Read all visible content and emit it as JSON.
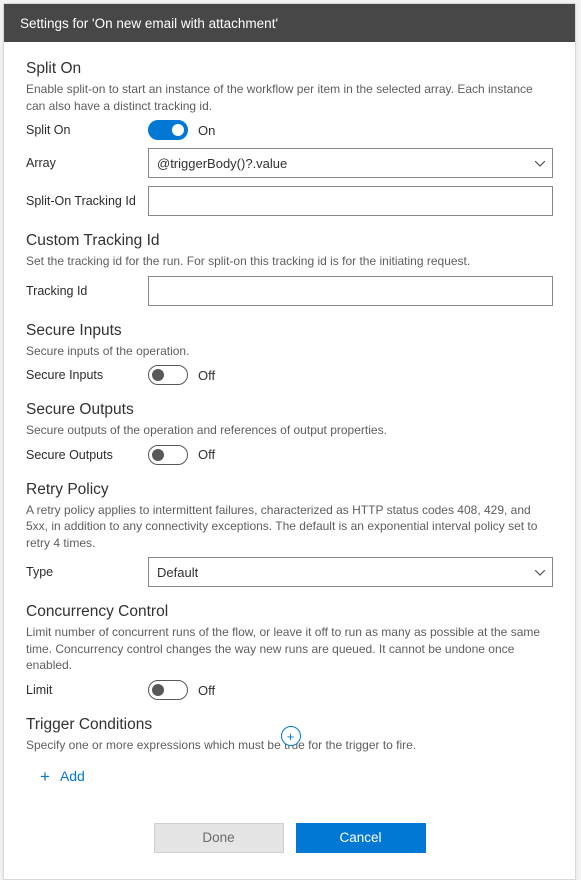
{
  "titlebar": "Settings for 'On new email with attachment'",
  "sections": {
    "splitOn": {
      "title": "Split On",
      "desc": "Enable split-on to start an instance of the workflow per item in the selected array. Each instance can also have a distinct tracking id.",
      "toggleLabel": "Split On",
      "toggleState": "On",
      "arrayLabel": "Array",
      "arrayValue": "@triggerBody()?.value",
      "trackingLabel": "Split-On Tracking Id",
      "trackingValue": ""
    },
    "customTracking": {
      "title": "Custom Tracking Id",
      "desc": "Set the tracking id for the run. For split-on this tracking id is for the initiating request.",
      "fieldLabel": "Tracking Id",
      "fieldValue": ""
    },
    "secureInputs": {
      "title": "Secure Inputs",
      "desc": "Secure inputs of the operation.",
      "toggleLabel": "Secure Inputs",
      "toggleState": "Off"
    },
    "secureOutputs": {
      "title": "Secure Outputs",
      "desc": "Secure outputs of the operation and references of output properties.",
      "toggleLabel": "Secure Outputs",
      "toggleState": "Off"
    },
    "retry": {
      "title": "Retry Policy",
      "desc": "A retry policy applies to intermittent failures, characterized as HTTP status codes 408, 429, and 5xx, in addition to any connectivity exceptions. The default is an exponential interval policy set to retry 4 times.",
      "typeLabel": "Type",
      "typeValue": "Default"
    },
    "concurrency": {
      "title": "Concurrency Control",
      "desc": "Limit number of concurrent runs of the flow, or leave it off to run as many as possible at the same time. Concurrency control changes the way new runs are queued. It cannot be undone once enabled.",
      "toggleLabel": "Limit",
      "toggleState": "Off"
    },
    "triggerConditions": {
      "title": "Trigger Conditions",
      "desc": "Specify one or more expressions which must be true for the trigger to fire.",
      "addLabel": "Add"
    }
  },
  "footer": {
    "done": "Done",
    "cancel": "Cancel"
  },
  "bottomPlus": "+"
}
